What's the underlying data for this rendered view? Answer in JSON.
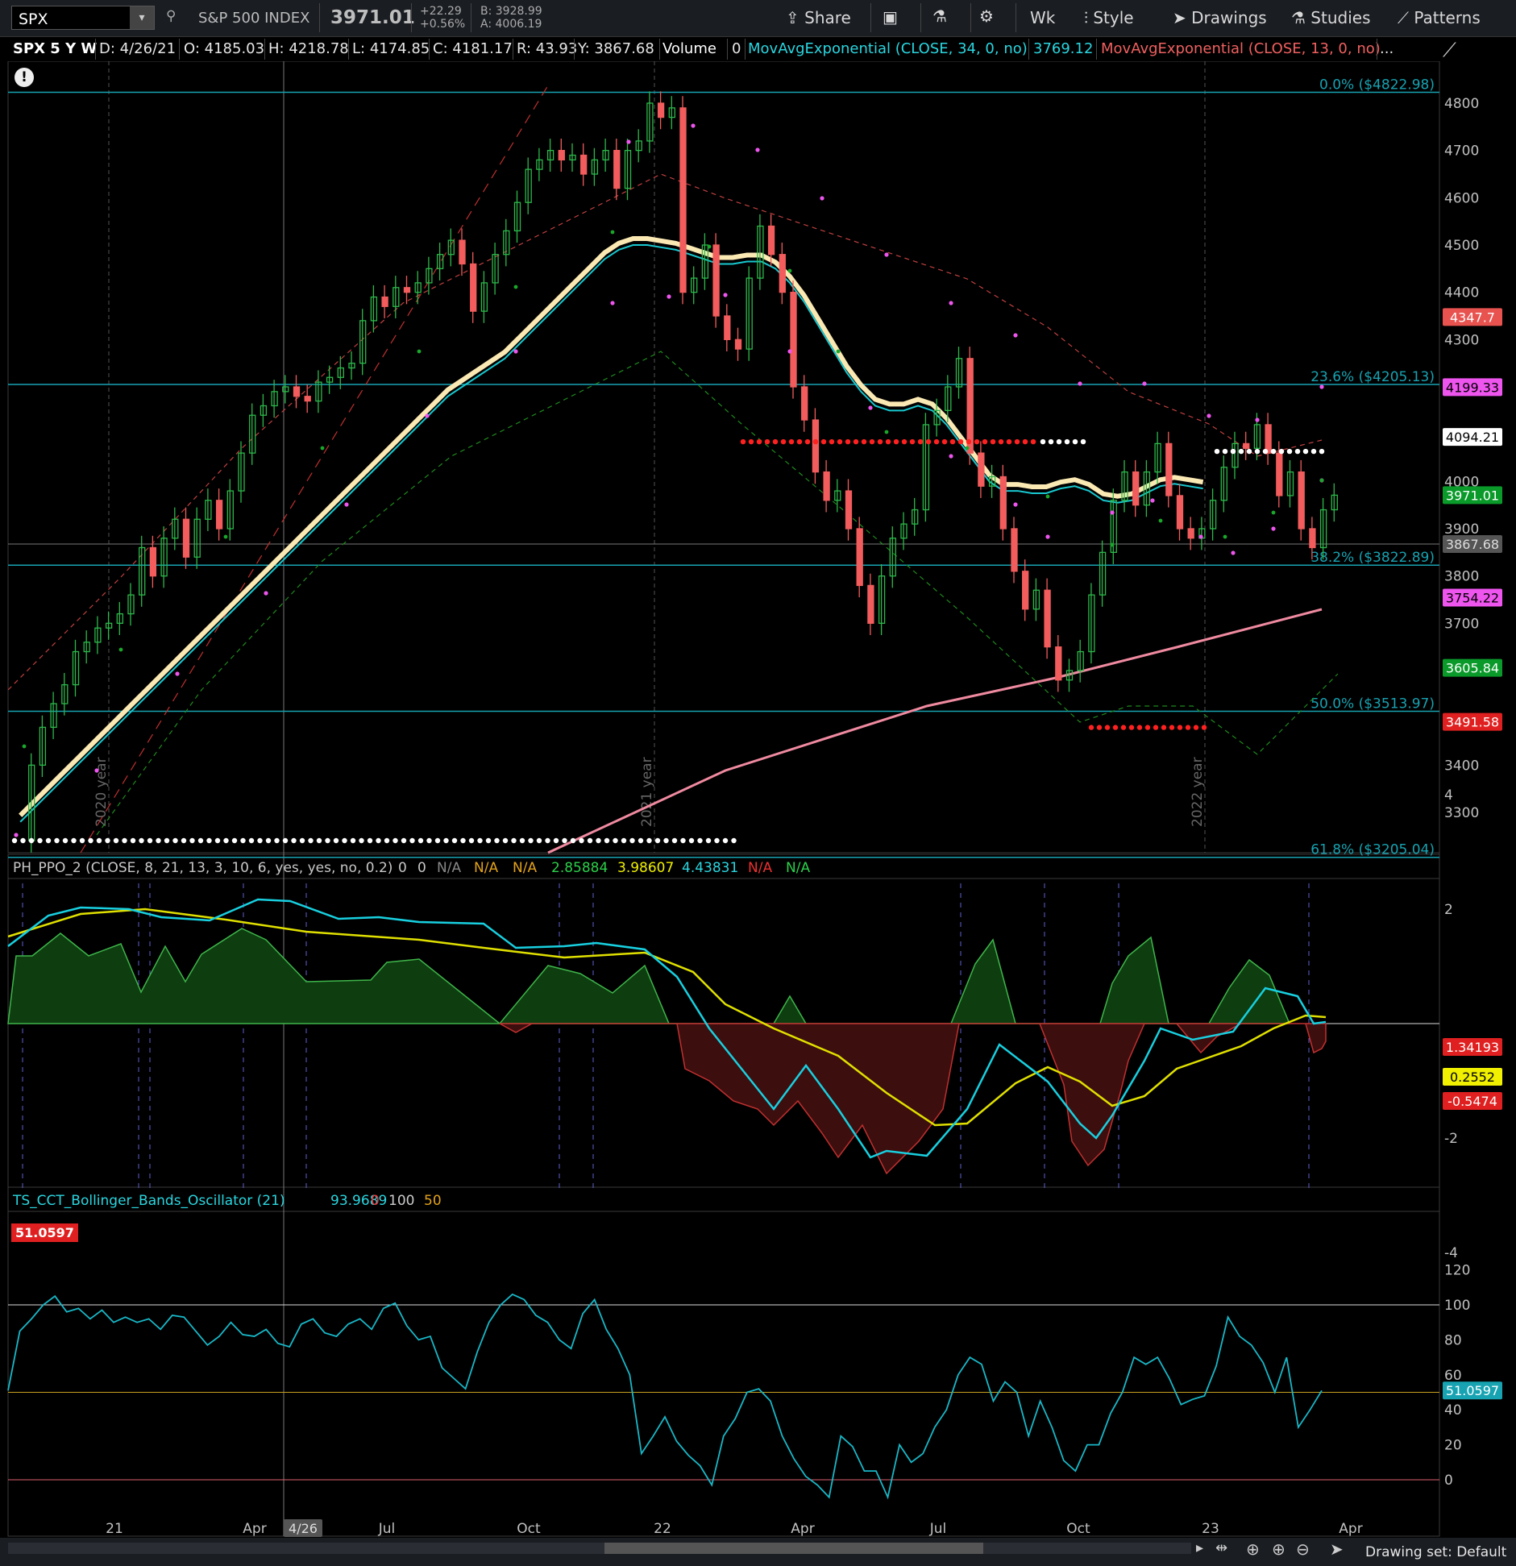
{
  "toolbar": {
    "symbol": "SPX",
    "index_name": "S&P 500 INDEX",
    "last_price": "3971.01",
    "change": "+22.29",
    "change_pct": "+0.56%",
    "bid": "B: 3928.99",
    "ask": "A: 4006.19",
    "share": "Share",
    "timeframe": "Wk",
    "style": "Style",
    "drawings": "Drawings",
    "studies": "Studies",
    "patterns": "Patterns"
  },
  "header": {
    "title": "SPX 5 Y W",
    "date": "D: 4/26/21",
    "open": "O: 4185.03",
    "high": "H: 4218.78",
    "low": "L: 4174.85",
    "close": "C: 4181.17",
    "range": "R: 43.93",
    "y": "Y: 3867.68",
    "volume_label": "Volume",
    "volume_value": "0",
    "ema34_label": "MovAvgExponential (CLOSE, 34, 0, no)",
    "ema34_value": "3769.12",
    "ema13_label": "MovAvgExponential (CLOSE, 13, 0, no)",
    "more": "..."
  },
  "price_panel": {
    "fib_levels": [
      {
        "label": "0.0% ($4822.98)",
        "value": 4822.98
      },
      {
        "label": "23.6% ($4205.13)",
        "value": 4205.13
      },
      {
        "label": "38.2% ($3822.89)",
        "value": 3822.89
      },
      {
        "label": "50.0% ($3513.97)",
        "value": 3513.97
      },
      {
        "label": "61.8% ($3205.04)",
        "value": 3205.04
      }
    ],
    "year_labels": [
      "2020 year",
      "2021 year",
      "2022 year"
    ],
    "price_badges": [
      {
        "text": "4347.7",
        "value": 4347.7,
        "bg": "#e8524f",
        "fg": "#ffffff"
      },
      {
        "text": "4199.33",
        "value": 4199.33,
        "bg": "#ee55ee",
        "fg": "#000000"
      },
      {
        "text": "4094.21",
        "value": 4094.21,
        "bg": "#ffffff",
        "fg": "#000000"
      },
      {
        "text": "3971.01",
        "value": 3971.01,
        "bg": "#0a9a2a",
        "fg": "#ffffff"
      },
      {
        "text": "3867.68",
        "value": 3867.68,
        "bg": "#555555",
        "fg": "#dddddd"
      },
      {
        "text": "3754.22",
        "value": 3754.22,
        "bg": "#ee55ee",
        "fg": "#000000"
      },
      {
        "text": "3605.84",
        "value": 3605.84,
        "bg": "#0a9a2a",
        "fg": "#ffffff"
      },
      {
        "text": "3491.58",
        "value": 3491.58,
        "bg": "#e02020",
        "fg": "#ffffff"
      }
    ],
    "y_ticks": [
      "4800",
      "4700",
      "4600",
      "4500",
      "4400",
      "4300",
      "4000",
      "3900",
      "3800",
      "3700",
      "3400",
      "3300"
    ]
  },
  "ppo_panel": {
    "label": "PH_PPO_2 (CLOSE, 8, 21, 13, 3, 10, 6, yes, yes, no, 0.2)",
    "v0": "0",
    "v1": "0",
    "v2": "N/A",
    "v3": "N/A",
    "v4": "N/A",
    "v5": "2.85884",
    "v6": "3.98607",
    "v7": "4.43831",
    "v8": "N/A",
    "v9": "N/A",
    "y_ticks": [
      "4",
      "2",
      "-2",
      "-4"
    ],
    "badges": [
      {
        "text": "1.34193",
        "value": 1.34193,
        "bg": "#e02020",
        "fg": "#ffffff"
      },
      {
        "text": "0.2552",
        "value": 0.2552,
        "bg": "#f0f000",
        "fg": "#000000"
      },
      {
        "text": "-0.5474",
        "value": -0.5474,
        "bg": "#e02020",
        "fg": "#ffffff"
      }
    ]
  },
  "bbo_panel": {
    "label": "TS_CCT_Bollinger_Bands_Oscillator (21)",
    "value": "93.9689",
    "v1": "0",
    "v2": "100",
    "v3": "50",
    "corner_badge": "51.0597",
    "y_ticks": [
      "120",
      "100",
      "80",
      "60",
      "40",
      "20",
      "0"
    ],
    "badge": {
      "text": "51.0597",
      "value": 51.0597
    }
  },
  "x_axis": {
    "labels": [
      "21",
      "Apr",
      "4/26",
      "Jul",
      "Oct",
      "22",
      "Apr",
      "Jul",
      "Oct",
      "23",
      "Apr"
    ]
  },
  "bottom": {
    "drawing_set": "Drawing set: Default"
  },
  "chart_data": {
    "type": "candlestick",
    "symbol": "SPX",
    "interval": "weekly",
    "ylim": [
      3220,
      4870
    ],
    "ema34": [
      3280,
      3310,
      3340,
      3370,
      3400,
      3430,
      3460,
      3490,
      3520,
      3550,
      3580,
      3610,
      3640,
      3670,
      3700,
      3730,
      3760,
      3790,
      3820,
      3850,
      3880,
      3910,
      3940,
      3970,
      4000,
      4030,
      4060,
      4090,
      4120,
      4150,
      4180,
      4200,
      4220,
      4240,
      4260,
      4290,
      4320,
      4350,
      4380,
      4410,
      4440,
      4470,
      4490,
      4500,
      4500,
      4495,
      4490,
      4480,
      4470,
      4460,
      4460,
      4465,
      4465,
      4450,
      4420,
      4380,
      4330,
      4280,
      4230,
      4190,
      4160,
      4150,
      4150,
      4160,
      4150,
      4120,
      4080,
      4040,
      4000,
      3980,
      3980,
      3975,
      3975,
      3985,
      3990,
      3980,
      3960,
      3955,
      3960,
      3975,
      3990,
      3995,
      3990,
      3985
    ],
    "ohlc_close": [
      3240,
      3400,
      3480,
      3530,
      3570,
      3640,
      3660,
      3690,
      3700,
      3720,
      3760,
      3860,
      3800,
      3880,
      3920,
      3840,
      3920,
      3960,
      3900,
      3980,
      4060,
      4140,
      4160,
      4190,
      4200,
      4180,
      4170,
      4210,
      4220,
      4240,
      4250,
      4340,
      4390,
      4370,
      4410,
      4400,
      4420,
      4450,
      4480,
      4510,
      4460,
      4360,
      4420,
      4480,
      4530,
      4590,
      4660,
      4680,
      4700,
      4680,
      4690,
      4650,
      4680,
      4700,
      4620,
      4700,
      4720,
      4800,
      4770,
      4790,
      4400,
      4430,
      4500,
      4350,
      4300,
      4280,
      4430,
      4540,
      4480,
      4400,
      4200,
      4130,
      4020,
      3960,
      3980,
      3900,
      3780,
      3700,
      3800,
      3880,
      3910,
      3940,
      4120,
      4150,
      4200,
      4260,
      4060,
      3990,
      4010,
      3900,
      3810,
      3730,
      3770,
      3650,
      3580,
      3600,
      3640,
      3760,
      3850,
      3960,
      4020,
      3950,
      4020,
      4080,
      3970,
      3900,
      3880,
      3900,
      3960,
      4030,
      4080,
      4070,
      4120,
      4060,
      3970,
      4020,
      3900,
      3860,
      3940,
      3971
    ]
  }
}
